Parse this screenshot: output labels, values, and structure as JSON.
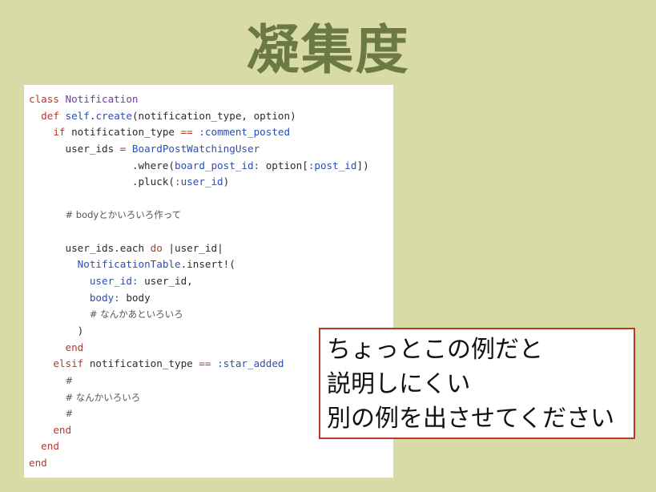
{
  "slide": {
    "title": "凝集度",
    "code_lines": [
      [
        {
          "t": "class",
          "c": "kw"
        },
        {
          "t": " "
        },
        {
          "t": "Notification",
          "c": "cls"
        }
      ],
      [
        {
          "t": "  "
        },
        {
          "t": "def",
          "c": "kw"
        },
        {
          "t": " "
        },
        {
          "t": "self",
          "c": "mth"
        },
        {
          "t": "."
        },
        {
          "t": "create",
          "c": "mth"
        },
        {
          "t": "(notification_type, option)"
        }
      ],
      [
        {
          "t": "    "
        },
        {
          "t": "if",
          "c": "kw"
        },
        {
          "t": " notification_type "
        },
        {
          "t": "==",
          "c": "op"
        },
        {
          "t": " "
        },
        {
          "t": ":comment_posted",
          "c": "sym"
        }
      ],
      [
        {
          "t": "      user_ids "
        },
        {
          "t": "=",
          "c": "op"
        },
        {
          "t": " "
        },
        {
          "t": "BoardPostWatchingUser",
          "c": "mth"
        }
      ],
      [
        {
          "t": "                 .where("
        },
        {
          "t": "board_post_id:",
          "c": "sym"
        },
        {
          "t": " option["
        },
        {
          "t": ":post_id",
          "c": "sym"
        },
        {
          "t": "])"
        }
      ],
      [
        {
          "t": "                 .pluck("
        },
        {
          "t": ":user_id",
          "c": "sym"
        },
        {
          "t": ")"
        }
      ],
      [],
      [
        {
          "t": "      "
        },
        {
          "t": "# bodyとかいろいろ作って",
          "c": "cmt"
        }
      ],
      [],
      [
        {
          "t": "      user_ids.each "
        },
        {
          "t": "do",
          "c": "kw"
        },
        {
          "t": " |user_id|"
        }
      ],
      [
        {
          "t": "        "
        },
        {
          "t": "NotificationTable",
          "c": "mth"
        },
        {
          "t": ".insert!("
        }
      ],
      [
        {
          "t": "          "
        },
        {
          "t": "user_id:",
          "c": "sym"
        },
        {
          "t": " user_id,"
        }
      ],
      [
        {
          "t": "          "
        },
        {
          "t": "body:",
          "c": "sym"
        },
        {
          "t": " body"
        }
      ],
      [
        {
          "t": "          "
        },
        {
          "t": "# なんかあといろいろ",
          "c": "cmt"
        }
      ],
      [
        {
          "t": "        )"
        }
      ],
      [
        {
          "t": "      "
        },
        {
          "t": "end",
          "c": "kw"
        }
      ],
      [
        {
          "t": "    "
        },
        {
          "t": "elsif",
          "c": "kw"
        },
        {
          "t": " notification_type "
        },
        {
          "t": "==",
          "c": "op"
        },
        {
          "t": " "
        },
        {
          "t": ":star_added",
          "c": "sym"
        }
      ],
      [
        {
          "t": "      "
        },
        {
          "t": "#",
          "c": "cmt"
        }
      ],
      [
        {
          "t": "      "
        },
        {
          "t": "# なんかいろいろ",
          "c": "cmt"
        }
      ],
      [
        {
          "t": "      "
        },
        {
          "t": "#",
          "c": "cmt"
        }
      ],
      [
        {
          "t": "    "
        },
        {
          "t": "end",
          "c": "kw"
        }
      ],
      [
        {
          "t": "  "
        },
        {
          "t": "end",
          "c": "kw"
        }
      ],
      [
        {
          "t": "end",
          "c": "kw"
        }
      ]
    ],
    "callout_lines": [
      "ちょっとこの例だと",
      "説明しにくい",
      "別の例を出させてください"
    ]
  }
}
